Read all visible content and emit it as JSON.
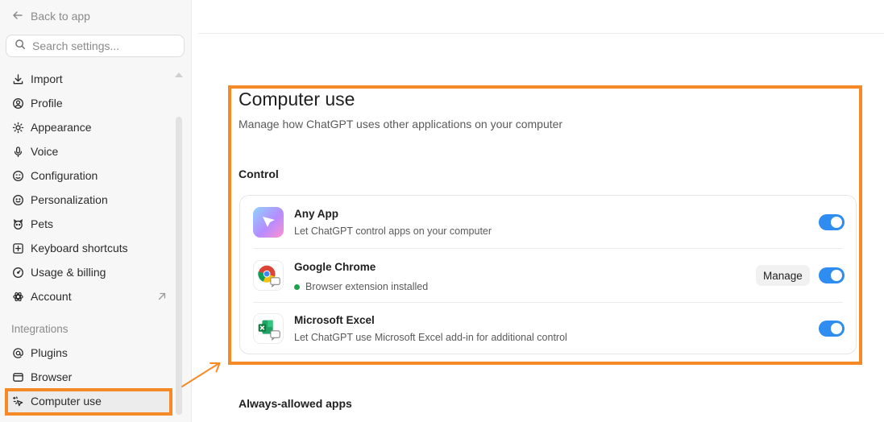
{
  "sidebar": {
    "back_label": "Back to app",
    "search_placeholder": "Search settings...",
    "items": [
      {
        "label": "Import",
        "icon": "download-icon"
      },
      {
        "label": "Profile",
        "icon": "user-circle-icon"
      },
      {
        "label": "Appearance",
        "icon": "sun-icon"
      },
      {
        "label": "Voice",
        "icon": "microphone-icon"
      },
      {
        "label": "Configuration",
        "icon": "settings-face-icon"
      },
      {
        "label": "Personalization",
        "icon": "smile-icon"
      },
      {
        "label": "Pets",
        "icon": "pet-icon"
      },
      {
        "label": "Keyboard shortcuts",
        "icon": "keyboard-plus-icon"
      },
      {
        "label": "Usage & billing",
        "icon": "gauge-icon"
      },
      {
        "label": "Account",
        "icon": "openai-logo-icon"
      }
    ],
    "integrations_label": "Integrations",
    "integration_items": [
      {
        "label": "Plugins",
        "icon": "at-icon"
      },
      {
        "label": "Browser",
        "icon": "browser-window-icon"
      },
      {
        "label": "Computer use",
        "icon": "cursor-sparkle-icon"
      }
    ]
  },
  "main": {
    "title": "Computer use",
    "subtitle": "Manage how ChatGPT uses other applications on your computer",
    "control_heading": "Control",
    "apps": [
      {
        "name": "Any App",
        "description": "Let ChatGPT control apps on your computer",
        "enabled": true
      },
      {
        "name": "Google Chrome",
        "description": "Browser extension installed",
        "manage_label": "Manage",
        "enabled": true,
        "status_color": "#1aa34a"
      },
      {
        "name": "Microsoft Excel",
        "description": "Let ChatGPT use Microsoft Excel add-in for additional control",
        "enabled": true
      }
    ],
    "always_allowed_heading": "Always-allowed apps"
  },
  "colors": {
    "accent_highlight": "#f58a26",
    "toggle_on": "#2f8cf0"
  }
}
